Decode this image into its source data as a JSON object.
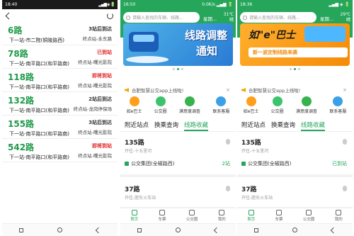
{
  "phone1": {
    "status_time": "18:40",
    "status_right": "▂▄▆ ◈ 🔋",
    "routes": [
      {
        "name": "6路",
        "status": "3站后到达",
        "status_color": "normal",
        "next": "下一站-市二院(铜陵路西)",
        "terminal": "终点站-永东路"
      },
      {
        "name": "78路",
        "status": "已到站",
        "status_color": "red",
        "next": "下一站-南平路口(和平路南)",
        "terminal": "终点站-曙光影院"
      },
      {
        "name": "118路",
        "status": "即将到站",
        "status_color": "red",
        "next": "下一站-南平路口(和平路南)",
        "terminal": "终点站-曙光影院"
      },
      {
        "name": "132路",
        "status": "2站后到达",
        "status_color": "normal",
        "next": "下一站-南平路口(和平路南)",
        "terminal": "终点站-龙岗停保场"
      },
      {
        "name": "155路",
        "status": "3站后到达",
        "status_color": "normal",
        "next": "下一站-南平路口(和平路南)",
        "terminal": "终点站-曙光影院"
      },
      {
        "name": "542路",
        "status": "即将到站",
        "status_color": "red",
        "next": "下一站-南平路口(和平路南)",
        "terminal": "终点站-曙光影院"
      }
    ]
  },
  "phone2": {
    "status_time": "16:50",
    "status_right": "0.0K/s ▂▄▆ 🔋",
    "search_placeholder": "请输入查找的车辆、线路...",
    "weekday": "星期...",
    "temp": "31℃",
    "temp_sub": "晴",
    "banner_line1": "线路调整",
    "banner_line2": "通知",
    "notice": "合肥智慧公交app上线啦!",
    "quick": [
      {
        "label": "如e巴士",
        "color": "#ff9f1c"
      },
      {
        "label": "公交圈",
        "color": "#3bc46c"
      },
      {
        "label": "满意度调查",
        "color": "#37b24d"
      },
      {
        "label": "联系客服",
        "color": "#3aa0e8"
      }
    ],
    "tabs": [
      "附近站点",
      "换乘查询",
      "线路收藏"
    ],
    "active_tab": 2,
    "fav": [
      {
        "name": "135路",
        "start": "开往-十五里河",
        "company": "公交集团(全椒路西)",
        "eta": "2站"
      },
      {
        "name": "37路",
        "start": "开往-肥东火车站",
        "company": "",
        "eta": ""
      }
    ],
    "bottom_nav": [
      "首页",
      "车票",
      "公交圈",
      "我的"
    ]
  },
  "phone3": {
    "status_time": "18:36",
    "status_right": "▂▄▆ ◈ 🔋",
    "search_placeholder": "请输入查找的车辆、线路...",
    "weekday": "星期...",
    "temp": "29℃",
    "temp_sub": "晴",
    "banner_title": "如\"e\"巴士",
    "banner_strip": "新一波定制线路来袭",
    "notice": "合肥智慧公交app上线啦!",
    "quick": [
      {
        "label": "如e巴士",
        "color": "#ff9f1c"
      },
      {
        "label": "公交圈",
        "color": "#3bc46c"
      },
      {
        "label": "满意度调查",
        "color": "#37b24d"
      },
      {
        "label": "联系客服",
        "color": "#3aa0e8"
      }
    ],
    "tabs": [
      "附近站点",
      "换乘查询",
      "线路收藏"
    ],
    "active_tab": 2,
    "fav": [
      {
        "name": "135路",
        "start": "开往-十五里河",
        "company": "公交集团(全椒路西)",
        "eta": "已到站"
      },
      {
        "name": "37路",
        "start": "开往-肥东火车站",
        "company": "",
        "eta": ""
      }
    ],
    "bottom_nav": [
      "首页",
      "车票",
      "公交圈",
      "我的"
    ]
  },
  "colors": {
    "accent": "#26a65b",
    "alert": "#e02424"
  }
}
